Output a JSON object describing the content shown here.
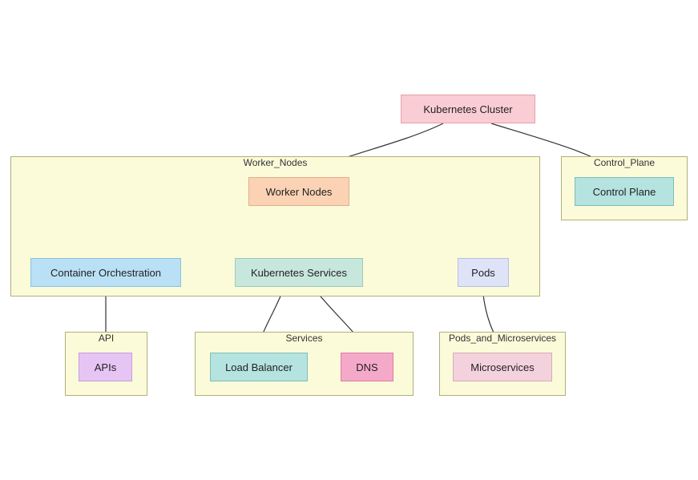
{
  "diagram": {
    "root": {
      "label": "Kubernetes Cluster"
    },
    "groups": {
      "worker_nodes": {
        "title": "Worker_Nodes"
      },
      "control_plane": {
        "title": "Control_Plane"
      },
      "api": {
        "title": "API"
      },
      "services": {
        "title": "Services"
      },
      "pods_micro": {
        "title": "Pods_and_Microservices"
      }
    },
    "nodes": {
      "worker_nodes_box": {
        "label": "Worker Nodes"
      },
      "control_plane_box": {
        "label": "Control Plane"
      },
      "container_orch": {
        "label": "Container Orchestration"
      },
      "k8s_services": {
        "label": "Kubernetes Services"
      },
      "pods": {
        "label": "Pods"
      },
      "apis": {
        "label": "APIs"
      },
      "load_balancer": {
        "label": "Load Balancer"
      },
      "dns": {
        "label": "DNS"
      },
      "microservices": {
        "label": "Microservices"
      }
    }
  },
  "colors": {
    "group_bg": "#fbfbda",
    "group_border": "#b0b07a",
    "root_bg": "#f9cdd3",
    "root_border": "#e4a0ab",
    "worker_bg": "#fbd3b4",
    "worker_border": "#e0af8a",
    "cp_bg": "#b4e3e0",
    "cp_border": "#7fbdb9",
    "co_bg": "#b9e0f5",
    "co_border": "#8bc2dc",
    "ks_bg": "#c8e7dc",
    "ks_border": "#9bcab9",
    "pods_bg": "#dfe3f8",
    "pods_border": "#b8bedf",
    "apis_bg": "#e6c5f4",
    "apis_border": "#c79ddb",
    "lb_bg": "#b4e3e0",
    "lb_border": "#7fbdb9",
    "dns_bg": "#f5a9c9",
    "dns_border": "#de7da6",
    "micro_bg": "#f4d2dd",
    "micro_border": "#dba8b9"
  }
}
